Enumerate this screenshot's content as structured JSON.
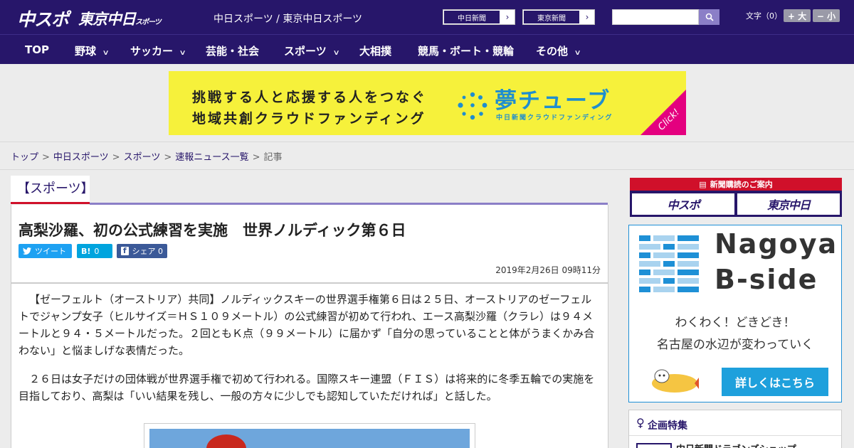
{
  "header": {
    "logo_main": "中スポ",
    "logo_tokyo": "東京中日",
    "logo_tokyo_small": "スポーツ",
    "site_names": "中日スポーツ / 東京中日スポーツ",
    "paper_buttons": [
      {
        "label": "中日新聞",
        "arrow": "›"
      },
      {
        "label": "東京新聞",
        "arrow": "›"
      }
    ],
    "search": {
      "placeholder": ""
    },
    "font_size_label": "文字（0）",
    "font_larger": "+ 大",
    "font_smaller": "− 小"
  },
  "nav": {
    "items": [
      {
        "label": "TOP",
        "chevron": ""
      },
      {
        "label": "野球",
        "chevron": "∨"
      },
      {
        "label": "サッカー",
        "chevron": "∨"
      },
      {
        "label": "芸能・社会",
        "chevron": ""
      },
      {
        "label": "スポーツ",
        "chevron": "∨"
      },
      {
        "label": "大相撲",
        "chevron": ""
      },
      {
        "label": "競馬・ボート・競輪",
        "chevron": ""
      },
      {
        "label": "その他",
        "chevron": "∨"
      }
    ]
  },
  "banner": {
    "line1": "挑戦する人と応援する人をつなぐ",
    "line2": "地域共創クラウドファンディング",
    "brand": "夢チューブ",
    "brand_sub": "中日新聞クラウドファンディング",
    "click": "Click!",
    "colors": {
      "bg": "#f6f13b",
      "brand": "#1f8ecf",
      "click": "#e4007f"
    }
  },
  "breadcrumb": {
    "items": [
      "トップ",
      "中日スポーツ",
      "スポーツ",
      "速報ニュース一覧"
    ],
    "current": "記事",
    "separator": ">"
  },
  "category": {
    "label": "【スポーツ】"
  },
  "article": {
    "title": "高梨沙羅、初の公式練習を実施　世界ノルディック第６日",
    "share": {
      "tweet": "ツイート",
      "hatena_icon": "B!",
      "hatena_count": "0",
      "facebook_icon": "f",
      "facebook_label": "シェア",
      "facebook_count": "0"
    },
    "date": "2019年2月26日 09時11分",
    "paragraphs": [
      "【ゼーフェルト（オーストリア）共同】ノルディックスキーの世界選手権第６日は２５日、オーストリアのゼーフェルトでジャンプ女子（ヒルサイズ＝ＨＳ１０９メートル）の公式練習が初めて行われ、エース高梨沙羅（クラレ）は９４メートルと９４・５メートルだった。２回ともＫ点（９９メートル）に届かず「自分の思っていることと体がうまくかみ合わない」と悩ましげな表情だった。",
      "２６日は女子だけの団体戦が世界選手権で初めて行われる。国際スキー連盟（ＦＩＳ）は将来的に冬季五輪での実施を目指しており、高梨は「いい結果を残し、一般の方々に少しでも認知していただければ」と話した。"
    ]
  },
  "sidebar": {
    "subscribe_head": "新聞購読のご案内",
    "subscribe_logos": [
      "中スポ",
      "東京中日"
    ],
    "ad": {
      "title1": "Nagoya",
      "title2": "B-side",
      "line1": "わくわく！どきどき！",
      "line2": "名古屋の水辺が変わっていく",
      "button": "詳しくはこちら"
    },
    "feature": {
      "icon": "♀",
      "title": "企画特集",
      "item": "中日新聞ドラゴンズショップ"
    }
  }
}
